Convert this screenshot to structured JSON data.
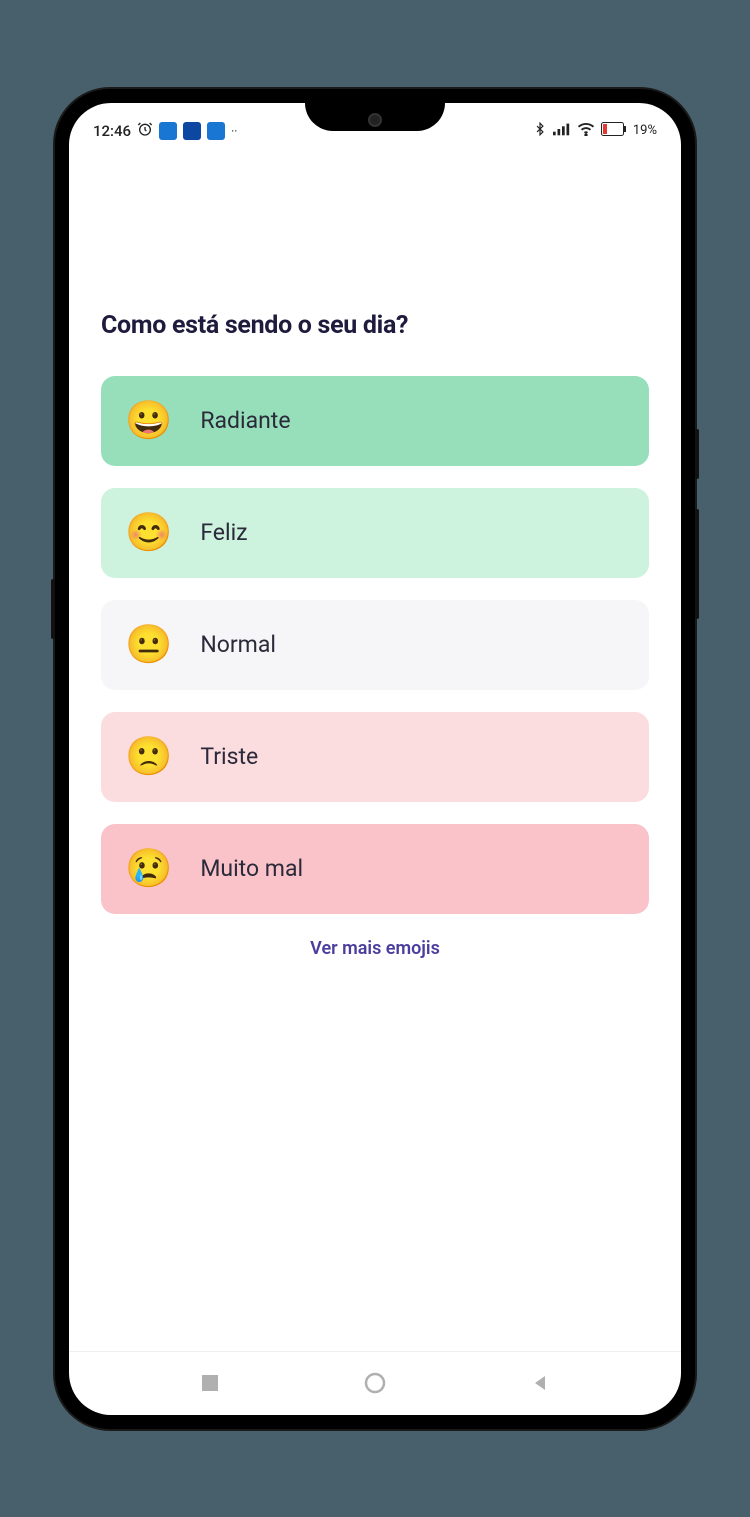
{
  "status": {
    "time": "12:46",
    "battery": "19%"
  },
  "question": "Como está sendo o seu dia?",
  "options": [
    {
      "emoji": "😀",
      "label": "Radiante"
    },
    {
      "emoji": "😊",
      "label": "Feliz"
    },
    {
      "emoji": "😐",
      "label": "Normal"
    },
    {
      "emoji": "🙁",
      "label": "Triste"
    },
    {
      "emoji": "😢",
      "label": "Muito mal"
    }
  ],
  "more_link": "Ver mais emojis"
}
